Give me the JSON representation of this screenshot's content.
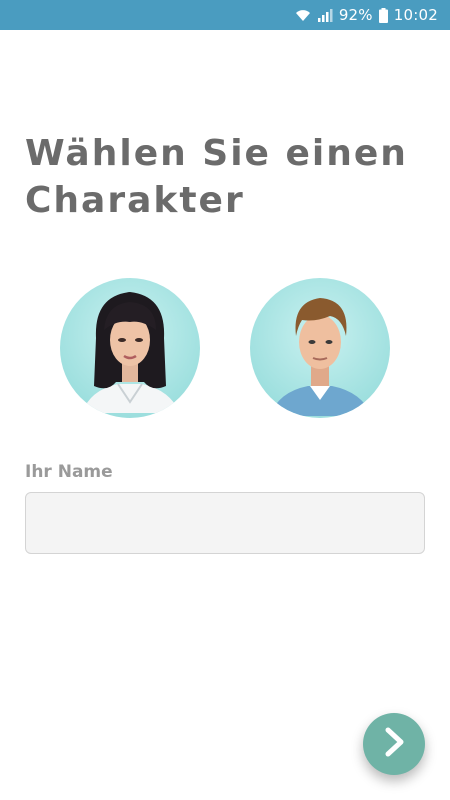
{
  "status_bar": {
    "battery": "92%",
    "time": "10:02",
    "icons": [
      "wifi-icon",
      "signal-icon",
      "battery-icon"
    ]
  },
  "title": "Wählen Sie einen Charakter",
  "characters": [
    {
      "id": "female",
      "icon": "female-character-avatar"
    },
    {
      "id": "male",
      "icon": "male-character-avatar"
    }
  ],
  "name_field": {
    "label": "Ihr Name",
    "value": "",
    "placeholder": ""
  },
  "next_button": {
    "icon": "chevron-right-icon"
  },
  "colors": {
    "status_bar": "#4a9cc0",
    "title": "#6b6b6b",
    "label": "#9a9a9a",
    "avatar_bg": "#a8e3e2",
    "fab": "#6fb3a6"
  }
}
